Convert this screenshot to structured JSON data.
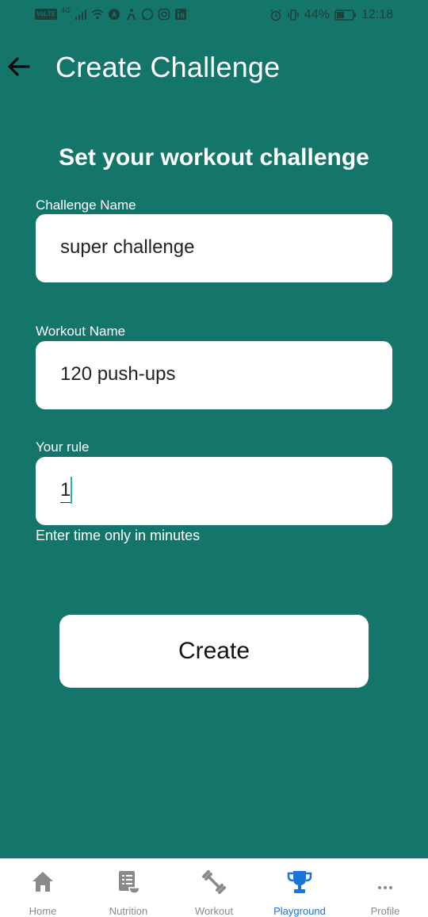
{
  "status_bar": {
    "left_badge": "VoLTE",
    "network": "4G",
    "battery_percent": "44%",
    "time": "12:18"
  },
  "header": {
    "title": "Create Challenge"
  },
  "form": {
    "subtitle": "Set your workout challenge",
    "challenge_name": {
      "label": "Challenge Name",
      "value": "super challenge"
    },
    "workout_name": {
      "label": "Workout Name",
      "value": "120 push-ups"
    },
    "rule": {
      "label": "Your rule",
      "value": "1",
      "helper": "Enter time only in minutes"
    },
    "submit_label": "Create"
  },
  "bottom_nav": {
    "items": [
      {
        "label": "Home",
        "icon": "home-icon"
      },
      {
        "label": "Nutrition",
        "icon": "nutrition-icon"
      },
      {
        "label": "Workout",
        "icon": "dumbbell-icon"
      },
      {
        "label": "Playground",
        "icon": "trophy-icon",
        "active": true
      },
      {
        "label": "Profile",
        "icon": "more-icon"
      }
    ],
    "active_color": "#1a73d9",
    "inactive_color": "#8a8a8a"
  },
  "colors": {
    "background": "#14756a",
    "card": "#ffffff",
    "cursor": "#22b5a8"
  }
}
